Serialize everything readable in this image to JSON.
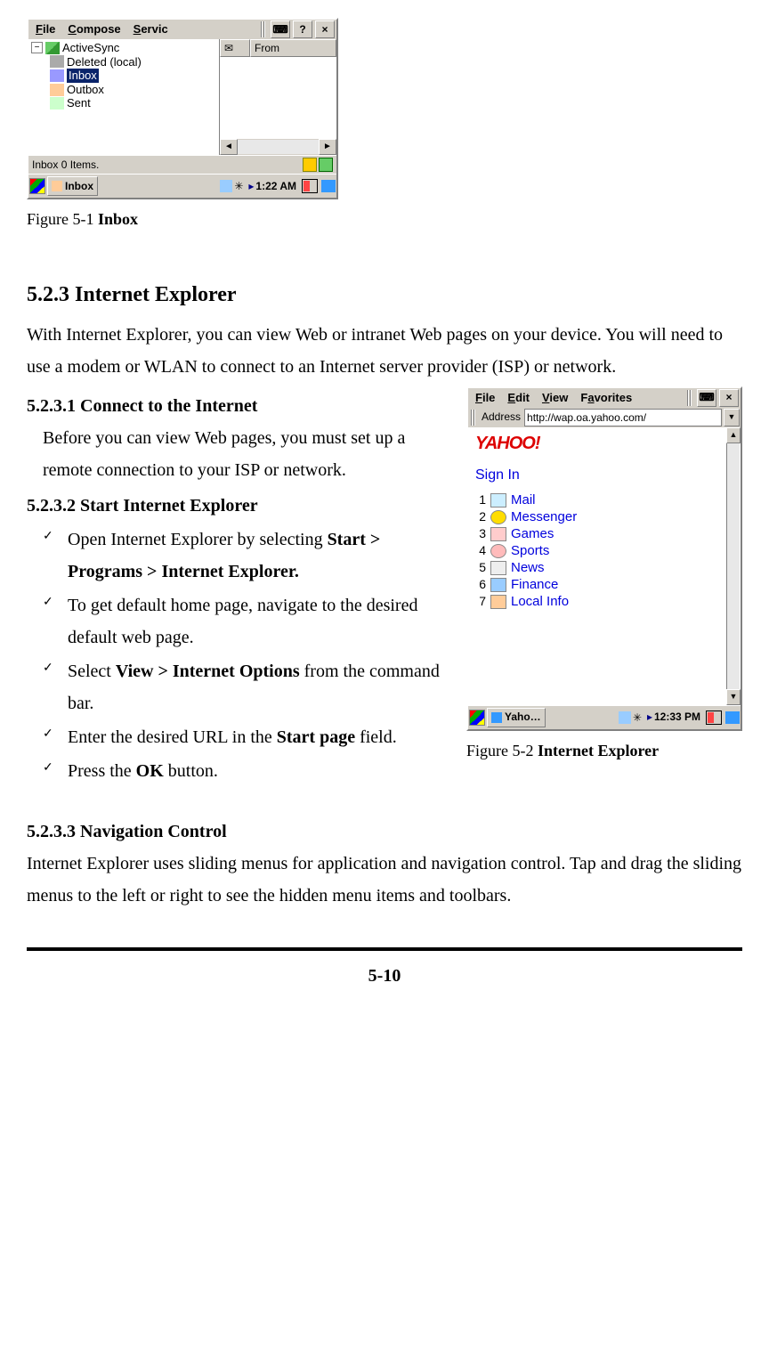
{
  "inbox_window": {
    "menus": {
      "file": "File",
      "compose": "Compose",
      "services": "Servic"
    },
    "help_btn": "?",
    "close_btn": "×",
    "from_col": "From",
    "tree": {
      "root": "ActiveSync",
      "items": [
        "Deleted (local)",
        "Inbox",
        "Outbox",
        "Sent"
      ],
      "selected_index": 1
    },
    "status": "Inbox 0 Items.",
    "task_label": "Inbox",
    "clock": "1:22 AM"
  },
  "figure1": {
    "prefix": "Figure 5-1 ",
    "bold": "Inbox"
  },
  "section_title": "5.2.3 Internet Explorer",
  "intro": "With Internet Explorer, you can view Web or intranet Web pages on your device. You will need to use a modem or WLAN to connect to an Internet server provider (ISP) or network.",
  "sub1_title": "5.2.3.1 Connect to the Internet",
  "sub1_body": "Before you can view Web pages, you must set up a remote connection to your ISP or network.",
  "sub2_title": "5.2.3.2 Start Internet Explorer",
  "bullets": {
    "b1a": "Open Internet Explorer by selecting ",
    "b1b": "Start > Programs > Internet Explorer.",
    "b2": "To get default home page, navigate to the desired default web page.",
    "b3a": "Select ",
    "b3b": "View > Internet Options",
    "b3c": " from the command bar.",
    "b4a": "Enter the desired URL in the ",
    "b4b": "Start page",
    "b4c": " field.",
    "b5a": "Press the ",
    "b5b": "OK",
    "b5c": " button."
  },
  "ie_window": {
    "menus": {
      "file": "File",
      "edit": "Edit",
      "view": "View",
      "fav": "Favorites"
    },
    "address_label": "Address",
    "address_value": "http://wap.oa.yahoo.com/",
    "logo": "YAHOO!",
    "signin": "Sign In",
    "links": [
      "Mail",
      "Messenger",
      "Games",
      "Sports",
      "News",
      "Finance",
      "Local Info"
    ],
    "task_label": "Yaho…",
    "clock": "12:33 PM"
  },
  "figure2": {
    "prefix": "Figure 5-2 ",
    "bold": "Internet Explorer"
  },
  "sub3_title": "5.2.3.3 Navigation Control",
  "sub3_body": "Internet Explorer uses sliding menus for application and navigation control. Tap and drag the sliding menus to the left or right to see the hidden menu items and toolbars.",
  "page_number": "5-10"
}
